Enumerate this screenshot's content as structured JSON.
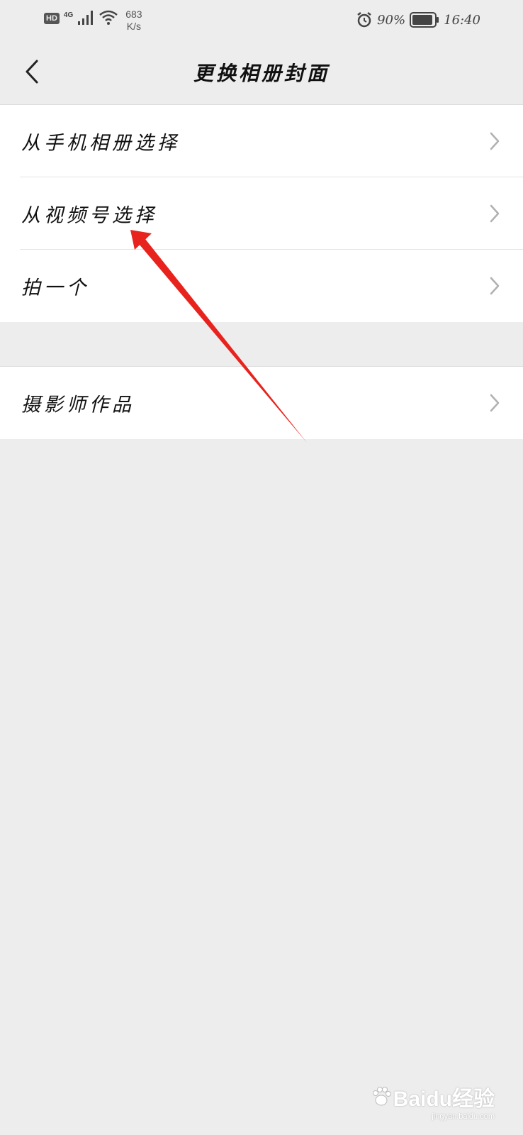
{
  "status_bar": {
    "hd_badge": "HD",
    "network_type": "4G",
    "speed_value": "683",
    "speed_unit": "K/s",
    "battery_percent": "90%",
    "time": "16:40",
    "icons": [
      "signal-icon",
      "wifi-icon",
      "alarm-icon",
      "battery-icon"
    ]
  },
  "header": {
    "title": "更换相册封面",
    "back_icon": "chevron-left-icon"
  },
  "menu_group_1": {
    "items": [
      {
        "label": "从手机相册选择"
      },
      {
        "label": "从视频号选择"
      },
      {
        "label": "拍一个"
      }
    ]
  },
  "menu_group_2": {
    "items": [
      {
        "label": "摄影师作品"
      }
    ]
  },
  "annotation": {
    "arrow_color": "#e8231d",
    "points_to": "从视频号选择"
  },
  "watermark": {
    "main": "Baidu经验",
    "sub": "jingyan.baidu.com"
  },
  "colors": {
    "background": "#ededed",
    "cell": "#ffffff",
    "chevron": "#b0b0b0"
  }
}
